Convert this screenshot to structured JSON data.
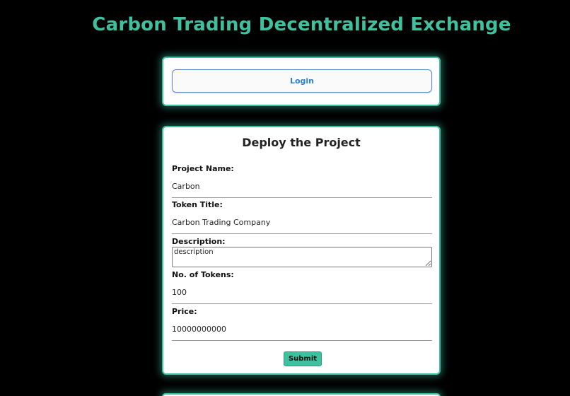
{
  "header": {
    "title": "Carbon Trading Decentralized Exchange"
  },
  "login": {
    "button_label": "Login"
  },
  "deploy": {
    "title": "Deploy the Project",
    "fields": {
      "project_name": {
        "label": "Project Name:",
        "value": "Carbon"
      },
      "token_title": {
        "label": "Token Title:",
        "value": "Carbon Trading Company"
      },
      "description": {
        "label": "Description:",
        "value": "description"
      },
      "num_tokens": {
        "label": "No. of Tokens:",
        "value": "100"
      },
      "price": {
        "label": "Price:",
        "value": "10000000000"
      }
    },
    "submit_label": "Submit"
  },
  "colors": {
    "accent": "#3fc1a0",
    "background": "#000000",
    "card": "#ffffff",
    "login_text": "#2f7fd6"
  }
}
